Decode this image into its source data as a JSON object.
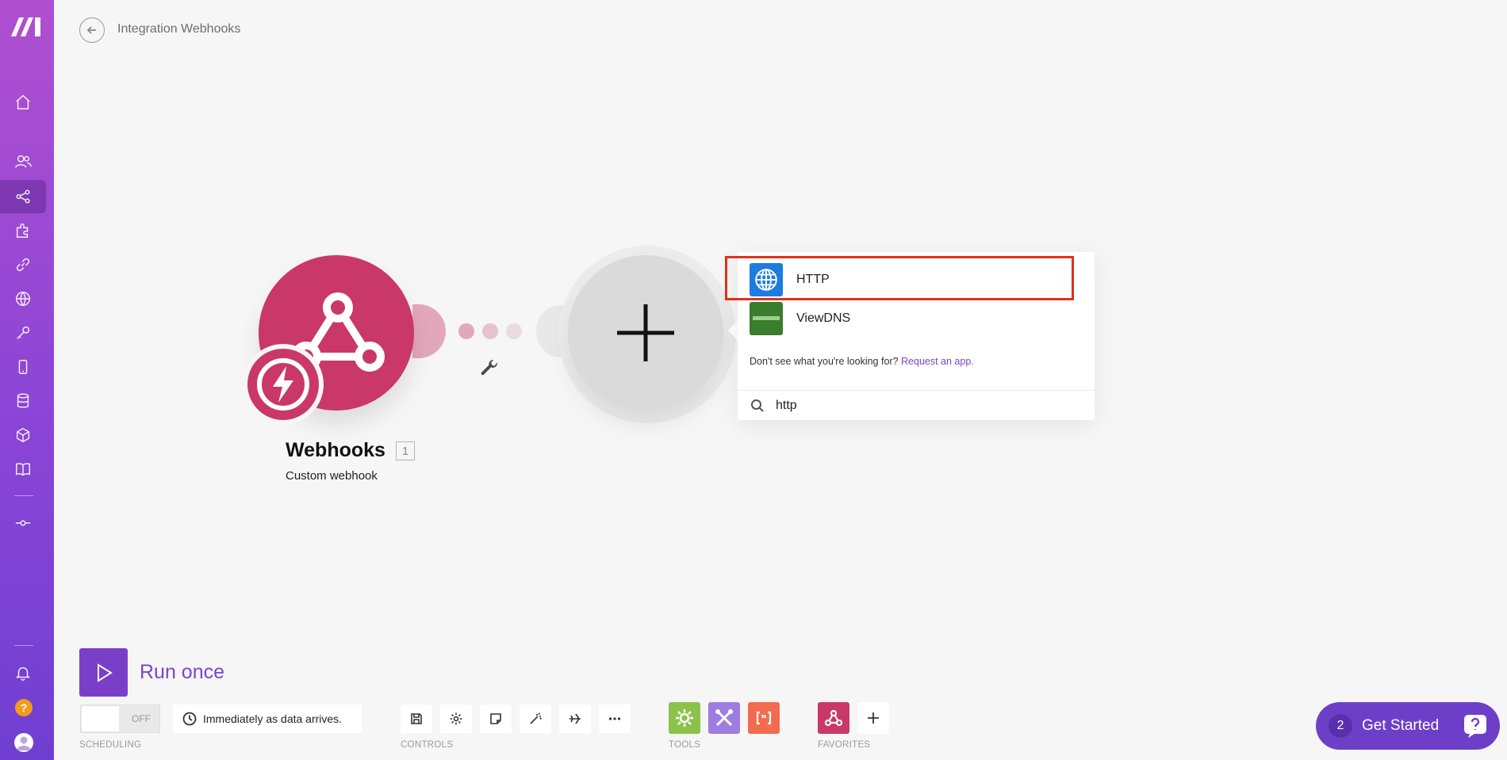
{
  "header": {
    "title": "Integration Webhooks"
  },
  "sidebar": {
    "items": [
      {
        "icon": "home-icon"
      },
      {
        "icon": "team-icon"
      },
      {
        "icon": "scenarios-icon",
        "active": true
      },
      {
        "icon": "apps-icon"
      },
      {
        "icon": "connections-icon"
      },
      {
        "icon": "webhooks-icon"
      },
      {
        "icon": "keys-icon"
      },
      {
        "icon": "devices-icon"
      },
      {
        "icon": "datastores-icon"
      },
      {
        "icon": "data-structures-icon"
      },
      {
        "icon": "docs-icon"
      },
      {
        "icon": "flow-icon"
      }
    ],
    "help_label": "?"
  },
  "canvas": {
    "webhook_module": {
      "name": "Webhooks",
      "subtitle": "Custom webhook",
      "count": "1",
      "color": "#c93868"
    }
  },
  "search_panel": {
    "results": [
      {
        "label": "HTTP",
        "icon": "http-globe-icon",
        "color": "#1d7ce0"
      },
      {
        "label": "ViewDNS",
        "icon": "viewdns-icon",
        "color": "#3a7d2c"
      }
    ],
    "hint_text": "Don't see what you're looking for?",
    "hint_link": "Request an app.",
    "query": "http"
  },
  "bottom_bar": {
    "run_label": "Run once",
    "toggle_label": "OFF",
    "schedule_text": "Immediately as data arrives.",
    "sections": {
      "scheduling": "SCHEDULING",
      "controls": "CONTROLS",
      "tools": "TOOLS",
      "favorites": "FAVORITES"
    },
    "tools": [
      {
        "icon": "flow-control-icon",
        "color": "#8bc34a"
      },
      {
        "icon": "tools-icon",
        "color": "#9f7de0"
      },
      {
        "icon": "text-parser-icon",
        "color": "#f26b4f"
      }
    ],
    "favorites": [
      {
        "icon": "webhooks-favorite-icon",
        "color": "#c93868"
      }
    ]
  },
  "get_started": {
    "count": "2",
    "label": "Get Started"
  }
}
